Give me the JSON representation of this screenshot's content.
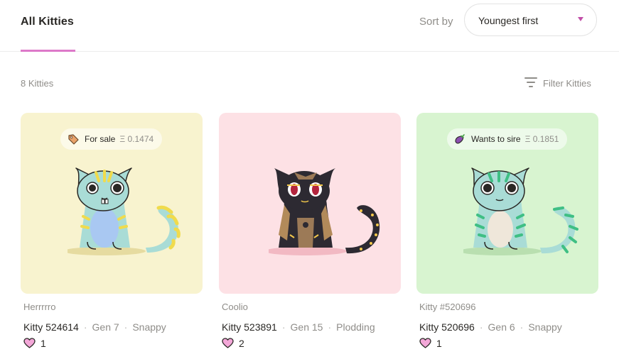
{
  "header": {
    "tab_label": "All Kitties",
    "sort_label": "Sort by",
    "sort_value": "Youngest first",
    "accent": "#dd79c9"
  },
  "toolbar": {
    "count_label": "8 Kitties",
    "filter_label": "Filter Kitties",
    "filter_icon": "filter-lines-icon"
  },
  "cards": [
    {
      "bg": "#f8f3cf",
      "pill": {
        "icon": "price-tag-icon",
        "label": "For sale",
        "price": "Ξ 0.1474"
      },
      "name": "Herrrrro",
      "id": "Kitty 524614",
      "gen": "Gen 7",
      "speed": "Snappy",
      "likes": "1"
    },
    {
      "bg": "#fde1e5",
      "pill": null,
      "name": "Coolio",
      "id": "Kitty 523891",
      "gen": "Gen 15",
      "speed": "Plodding",
      "likes": "2"
    },
    {
      "bg": "#d8f4d0",
      "pill": {
        "icon": "eggplant-icon",
        "label": "Wants to sire",
        "price": "Ξ 0.1851"
      },
      "name": "Kitty #520696",
      "id": "Kitty 520696",
      "gen": "Gen 6",
      "speed": "Snappy",
      "likes": "1"
    }
  ]
}
